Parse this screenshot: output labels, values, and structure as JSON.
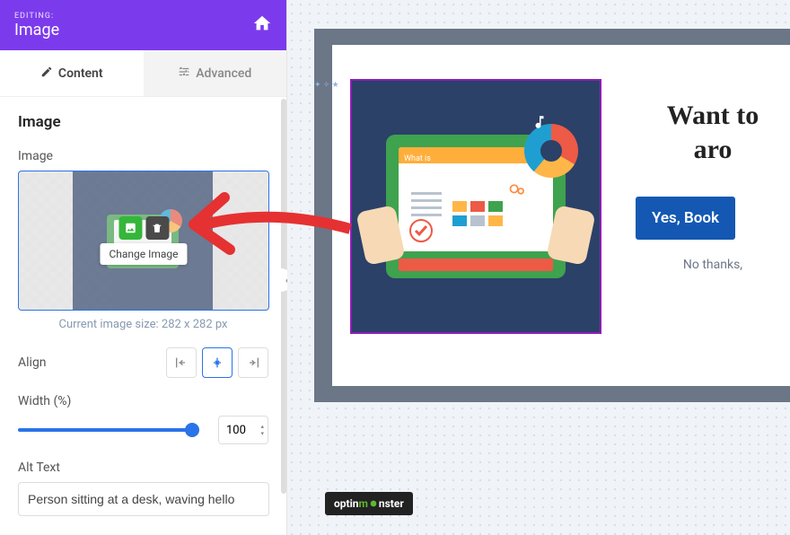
{
  "header": {
    "editing_label": "EDITING:",
    "title": "Image"
  },
  "tabs": {
    "content": "Content",
    "advanced": "Advanced"
  },
  "section": {
    "title": "Image"
  },
  "imageField": {
    "label": "Image",
    "tooltip": "Change Image",
    "size_caption": "Current image size: 282 x 282 px"
  },
  "align": {
    "label": "Align"
  },
  "width": {
    "label": "Width (%)",
    "value": "100"
  },
  "altText": {
    "label": "Alt Text",
    "value": "Person sitting at a desk, waving hello"
  },
  "canvas": {
    "heading_line1": "Want to ",
    "heading_line2": "aro",
    "cta": "Yes, Book ",
    "nothanks": "No thanks,"
  },
  "brand": {
    "prefix": "optin",
    "highlight": "m",
    "suffix": "nster"
  },
  "icons": {
    "home": "home-icon",
    "pencil": "pencil-icon",
    "sliders": "sliders-icon",
    "image_add": "image-add-icon",
    "trash": "trash-icon",
    "align_left": "align-left-icon",
    "align_center": "align-center-icon",
    "align_right": "align-right-icon",
    "chevron_left": "chevron-left-icon"
  }
}
